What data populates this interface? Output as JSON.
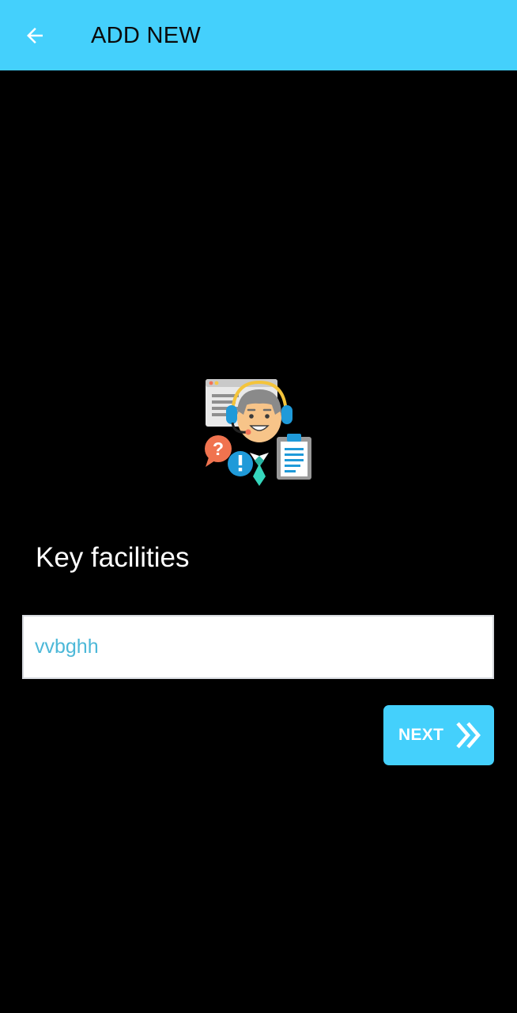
{
  "app_bar": {
    "title": "ADD NEW",
    "back_icon": "arrow-left-icon",
    "background_color": "#44d0fc"
  },
  "illustration": {
    "icon": "customer-support-agent-icon"
  },
  "form": {
    "label": "Key facilities",
    "input_value": "vvbghh",
    "input_text_color": "#4cb8d8"
  },
  "next_button": {
    "label": "NEXT",
    "icon": "double-chevron-right-icon",
    "background_color": "#44d0fc"
  }
}
